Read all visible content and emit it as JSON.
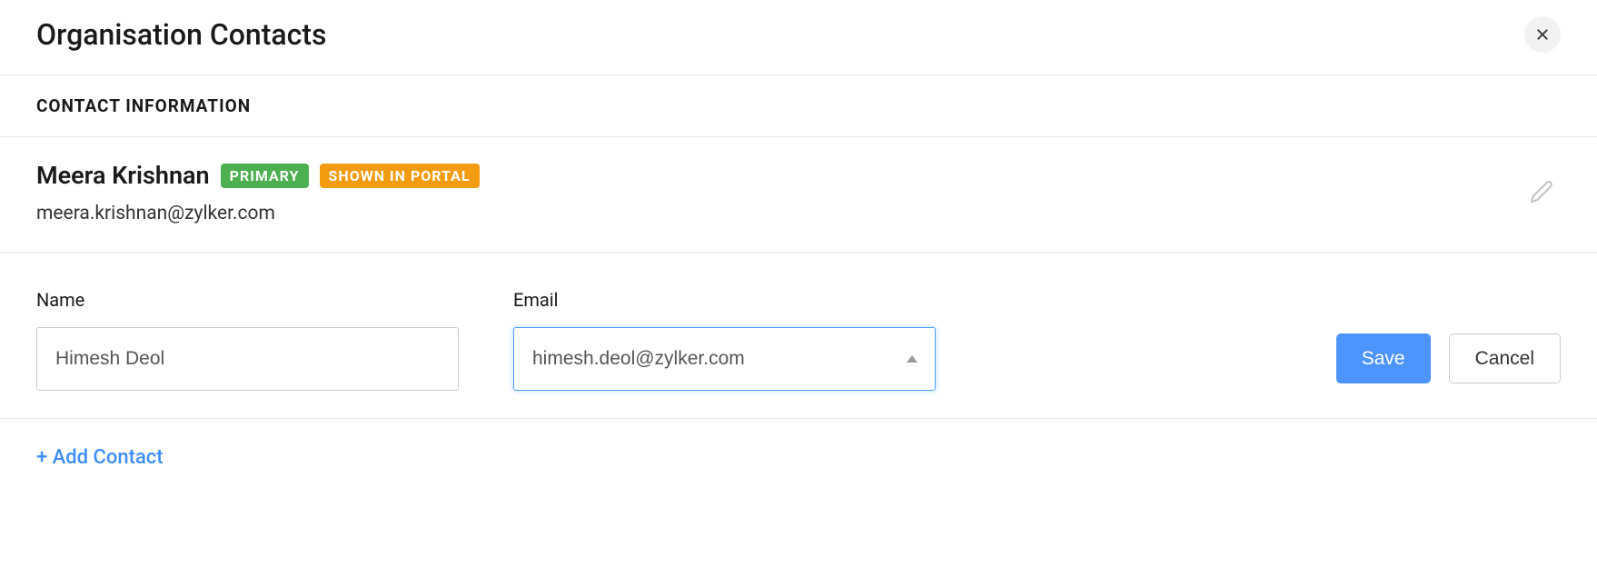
{
  "header": {
    "title": "Organisation Contacts"
  },
  "section": {
    "title": "CONTACT INFORMATION"
  },
  "contacts": [
    {
      "name": "Meera Krishnan",
      "email": "meera.krishnan@zylker.com",
      "badges": {
        "primary": "PRIMARY",
        "portal": "SHOWN IN PORTAL"
      }
    }
  ],
  "form": {
    "name_label": "Name",
    "email_label": "Email",
    "name_value": "Himesh Deol",
    "email_value": "himesh.deol@zylker.com",
    "save_label": "Save",
    "cancel_label": "Cancel"
  },
  "add_contact_label": "+ Add Contact"
}
